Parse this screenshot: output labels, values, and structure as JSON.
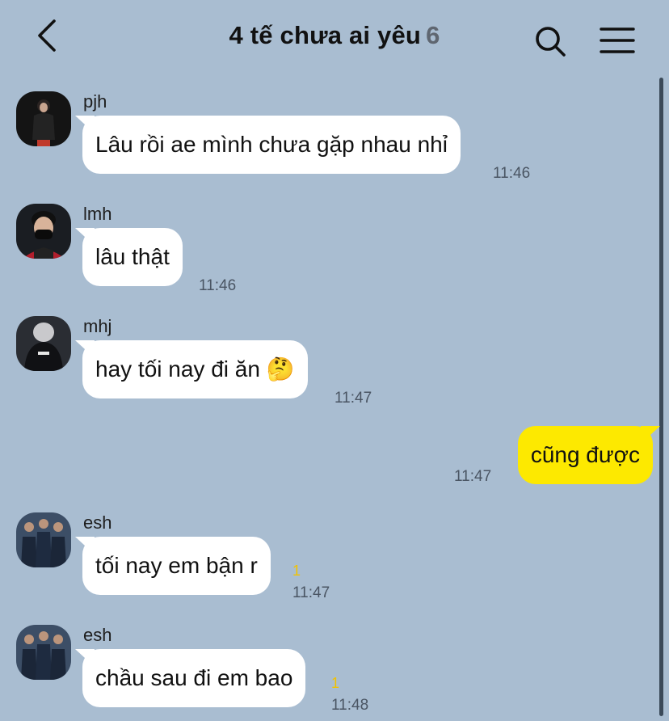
{
  "header": {
    "title": "4 tế chưa ai yêu",
    "member_count": "6",
    "back_icon": "chevron-left-icon",
    "search_icon": "search-icon",
    "menu_icon": "hamburger-menu-icon"
  },
  "colors": {
    "background": "#a9bdd1",
    "incoming_bubble": "#ffffff",
    "outgoing_bubble": "#fde900",
    "unread": "#f2c200"
  },
  "messages": [
    {
      "sender": "pjh",
      "text": "Lâu rồi ae mình chưa gặp nhau nhỉ",
      "time": "11:46"
    },
    {
      "sender": "lmh",
      "text": "lâu thật",
      "time": "11:46"
    },
    {
      "sender": "mhj",
      "text": "hay tối nay đi ăn 🤔",
      "time": "11:47"
    },
    {
      "sender": "me",
      "text": "cũng được",
      "time": "11:47"
    },
    {
      "sender": "esh",
      "text": "tối nay em bận r",
      "time": "11:47",
      "unread": "1"
    },
    {
      "sender": "esh",
      "text": "chầu sau đi em bao",
      "time": "11:48",
      "unread": "1"
    }
  ]
}
